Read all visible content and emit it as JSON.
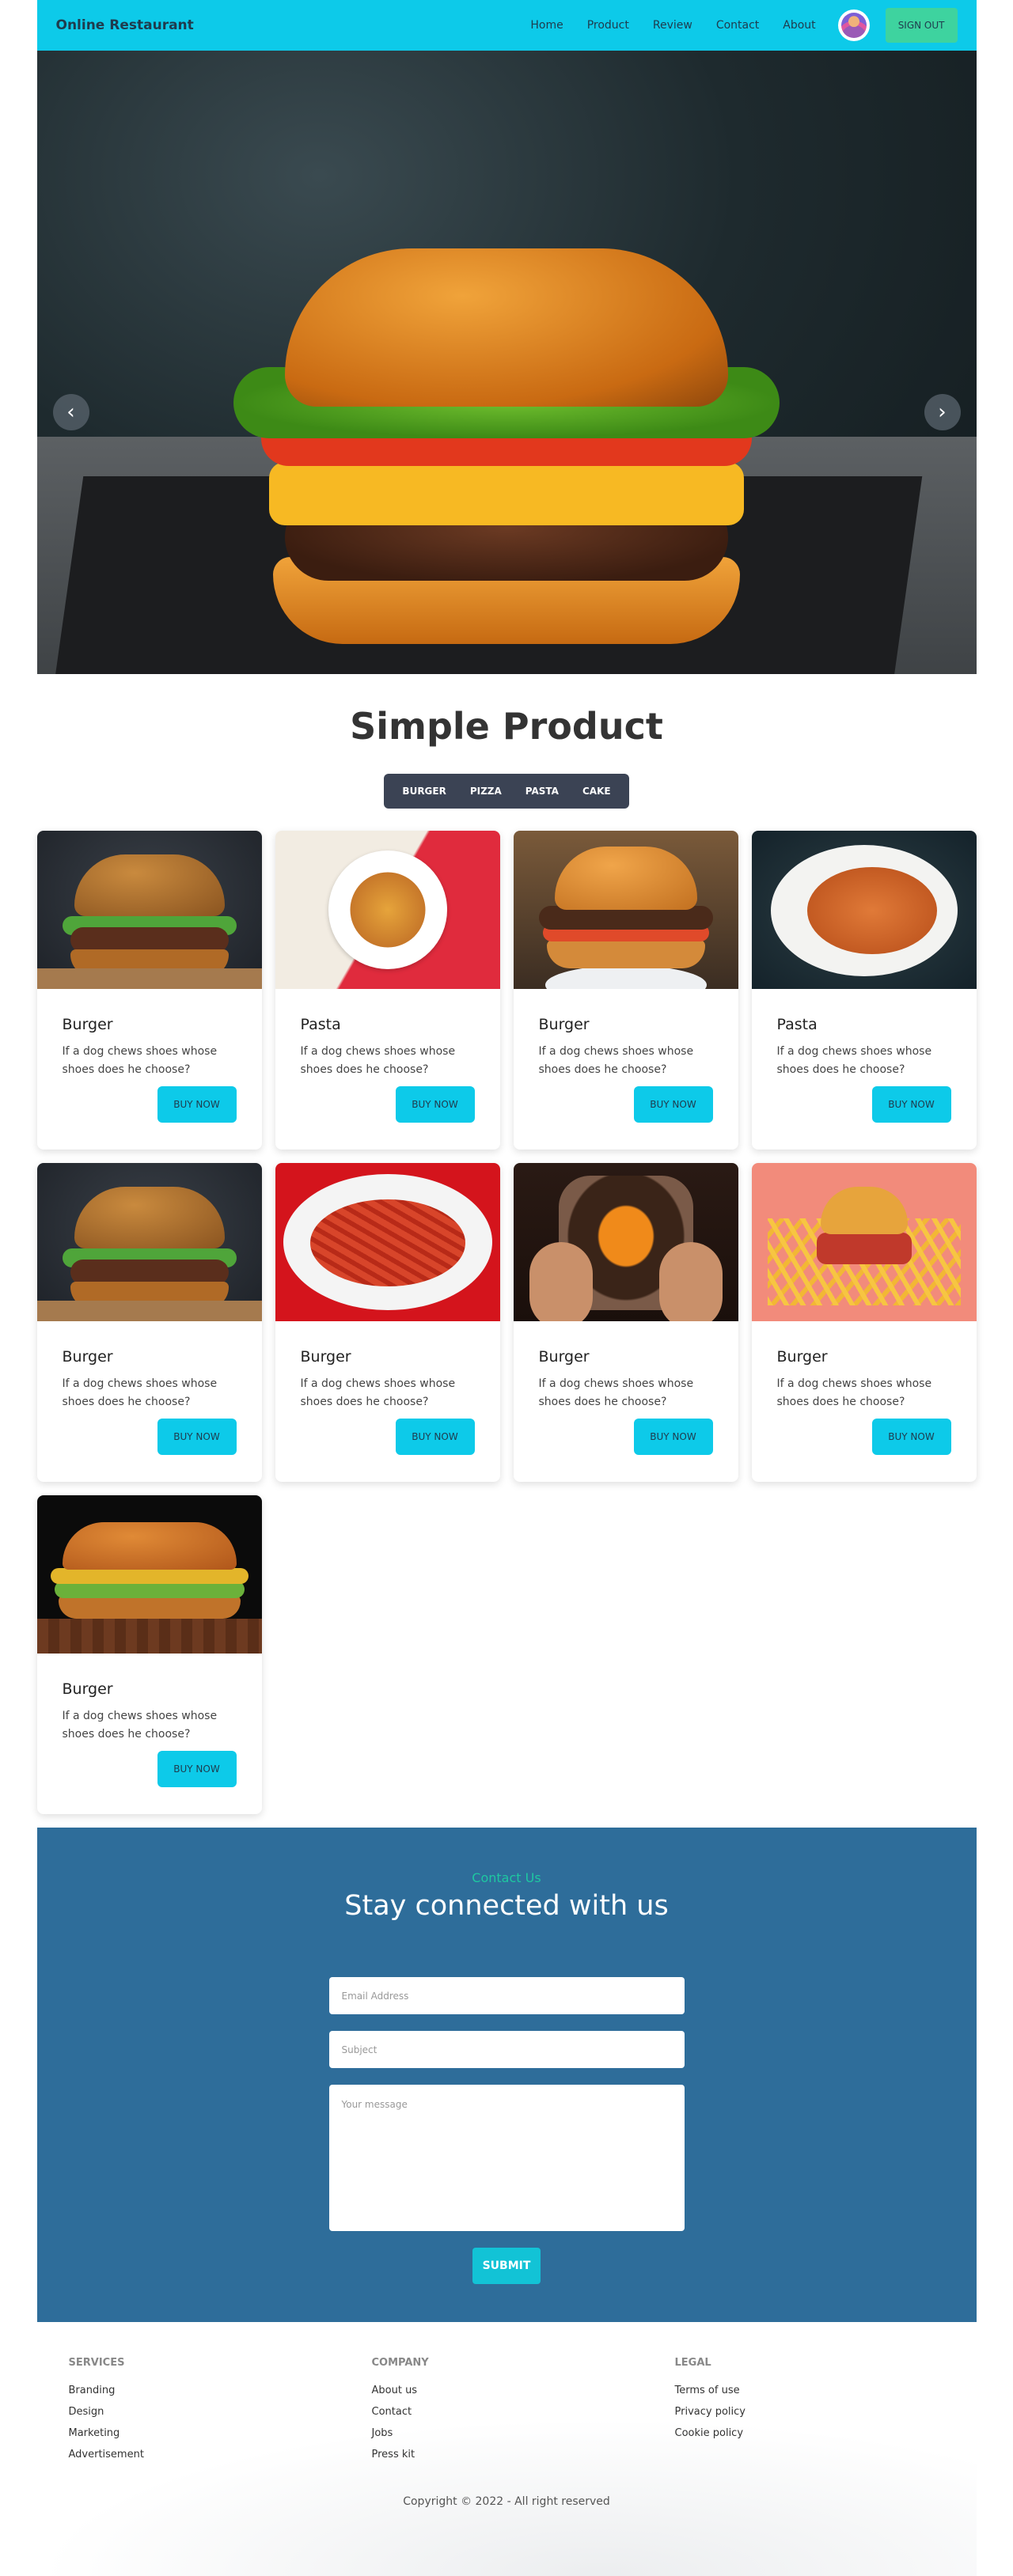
{
  "nav": {
    "brand": "Online Restaurant",
    "links": [
      "Home",
      "Product",
      "Review",
      "Contact",
      "About"
    ],
    "signout_label": "SIGN OUT"
  },
  "hero": {
    "prev_glyph": "‹",
    "next_glyph": "›"
  },
  "products": {
    "title": "Simple Product",
    "tabs": [
      "BURGER",
      "PIZZA",
      "PASTA",
      "CAKE"
    ],
    "buy_label": "BUY NOW",
    "items": [
      {
        "name": "Burger",
        "desc": "If a dog chews shoes whose shoes does he choose?"
      },
      {
        "name": "Pasta",
        "desc": "If a dog chews shoes whose shoes does he choose?"
      },
      {
        "name": "Burger",
        "desc": "If a dog chews shoes whose shoes does he choose?"
      },
      {
        "name": "Pasta",
        "desc": "If a dog chews shoes whose shoes does he choose?"
      },
      {
        "name": "Burger",
        "desc": "If a dog chews shoes whose shoes does he choose?"
      },
      {
        "name": "Burger",
        "desc": "If a dog chews shoes whose shoes does he choose?"
      },
      {
        "name": "Burger",
        "desc": "If a dog chews shoes whose shoes does he choose?"
      },
      {
        "name": "Burger",
        "desc": "If a dog chews shoes whose shoes does he choose?"
      },
      {
        "name": "Burger",
        "desc": "If a dog chews shoes whose shoes does he choose?"
      }
    ]
  },
  "contact": {
    "kicker": "Contact Us",
    "title": "Stay connected with us",
    "email_placeholder": "Email Address",
    "subject_placeholder": "Subject",
    "message_placeholder": "Your message",
    "submit_label": "SUBMIT"
  },
  "footer": {
    "services": {
      "heading": "SERVICES",
      "links": [
        "Branding",
        "Design",
        "Marketing",
        "Advertisement"
      ]
    },
    "company": {
      "heading": "COMPANY",
      "links": [
        "About us",
        "Contact",
        "Jobs",
        "Press kit"
      ]
    },
    "legal": {
      "heading": "LEGAL",
      "links": [
        "Terms of use",
        "Privacy policy",
        "Cookie policy"
      ]
    },
    "copyright": "Copyright © 2022 - All right reserved"
  },
  "colors": {
    "nav_bg": "#0dcae9",
    "signout_bg": "#3ed39f",
    "tabs_bg": "#3b4354",
    "buy_bg": "#0dcae9",
    "contact_bg": "#2e6d9a",
    "contact_kicker": "#1ec8a0",
    "submit_bg": "#12c3d6"
  }
}
